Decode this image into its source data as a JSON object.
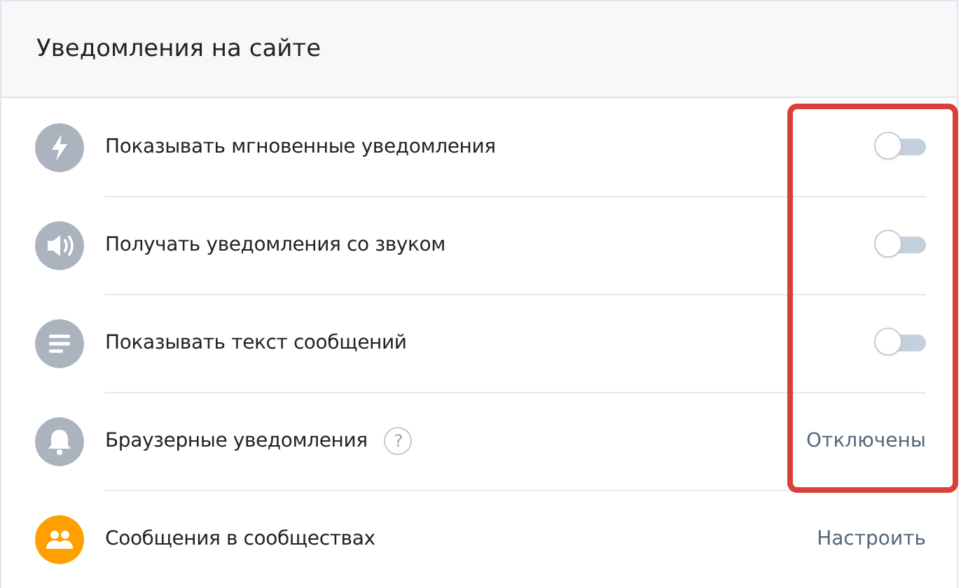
{
  "panel": {
    "title": "Уведомления на сайте"
  },
  "rows": [
    {
      "kind": "toggle",
      "color": "#aab3be",
      "label": "Показывать мгновенные уведомления",
      "on": false
    },
    {
      "kind": "toggle",
      "color": "#aab3be",
      "label": "Получать уведомления со звуком",
      "on": false
    },
    {
      "kind": "toggle",
      "color": "#aab3be",
      "label": "Показывать текст сообщений",
      "on": false
    },
    {
      "kind": "status",
      "color": "#aab3be",
      "label": "Браузерные уведомления",
      "help": "?",
      "value": "Отключены"
    },
    {
      "kind": "status",
      "color": "#ffa000",
      "label": "Сообщения в сообществах",
      "value": "Настроить"
    }
  ]
}
